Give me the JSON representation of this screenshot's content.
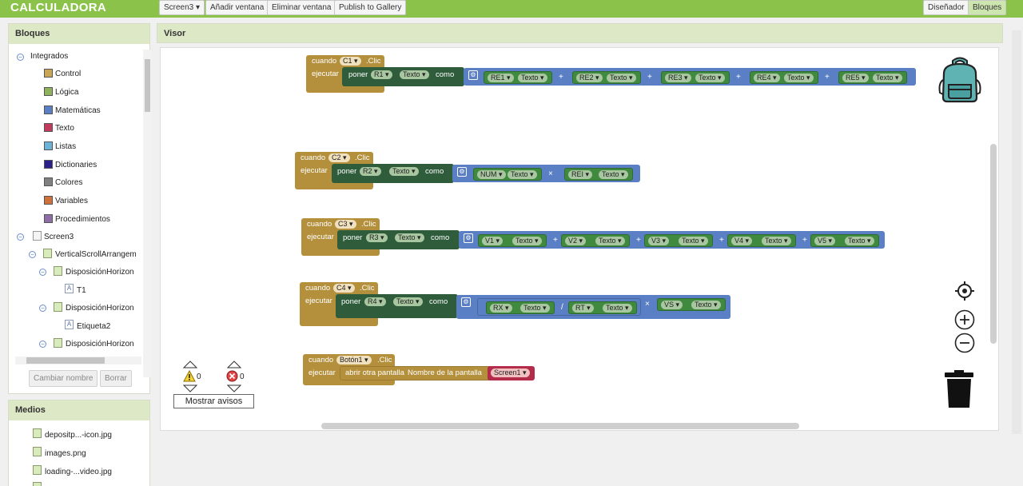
{
  "app": {
    "title": "CALCULADORA"
  },
  "toolbar": {
    "screen_select": "Screen3 ▾",
    "add_window": "Añadir ventana",
    "remove_window": "Eliminar ventana",
    "publish": "Publish to Gallery",
    "designer": "Diseñador",
    "blocks": "Bloques"
  },
  "blocks_panel": {
    "title": "Bloques",
    "builtin_label": "Integrados",
    "categories": [
      {
        "label": "Control",
        "color": "#c9a556"
      },
      {
        "label": "Lógica",
        "color": "#8fb35a"
      },
      {
        "label": "Matemáticas",
        "color": "#5b7fc4"
      },
      {
        "label": "Texto",
        "color": "#c23b5c"
      },
      {
        "label": "Listas",
        "color": "#6bb3d6"
      },
      {
        "label": "Dictionaries",
        "color": "#2b1f8a"
      },
      {
        "label": "Colores",
        "color": "#808080"
      },
      {
        "label": "Variables",
        "color": "#d0703a"
      },
      {
        "label": "Procedimientos",
        "color": "#8f6ea8"
      }
    ],
    "components": {
      "screen": "Screen3",
      "vertical": "VerticalScrollArrangem",
      "horiz1": "DisposiciónHorizon",
      "t1": "T1",
      "horiz2": "DisposiciónHorizon",
      "label2": "Etiqueta2",
      "horiz3": "DisposiciónHorizon"
    },
    "rename_button": "Cambiar nombre",
    "delete_button": "Borrar"
  },
  "media_panel": {
    "title": "Medios",
    "items": [
      "depositp...-icon.jpg",
      "images.png",
      "loading-...video.jpg"
    ]
  },
  "viewer": {
    "title": "Visor",
    "kw": {
      "when": "cuando",
      "do": "ejecutar",
      "set": "poner",
      "to": "como",
      "click": ".Clic",
      "text": "Texto"
    },
    "b1": {
      "comp": "C1",
      "target": "R1",
      "operands": [
        "RE1",
        "RE2",
        "RE3",
        "RE4",
        "RE5"
      ]
    },
    "b2": {
      "comp": "C2",
      "target": "R2",
      "operands": [
        "NUM",
        "REI"
      ]
    },
    "b3": {
      "comp": "C3",
      "target": "R3",
      "operands": [
        "V1",
        "V2",
        "V3",
        "V4",
        "V5"
      ]
    },
    "b4": {
      "comp": "C4",
      "target": "R4",
      "operands": [
        "RX",
        "RT",
        "VS"
      ]
    },
    "b5": {
      "comp": "Botón1",
      "action": "abrir otra pantalla",
      "param": "Nombre de la pantalla",
      "screen": "Screen1"
    },
    "ops": {
      "plus": "+",
      "times": "×",
      "div": "/"
    },
    "warnings": {
      "count": "0",
      "errors": "0",
      "show_label": "Mostrar avisos"
    }
  }
}
